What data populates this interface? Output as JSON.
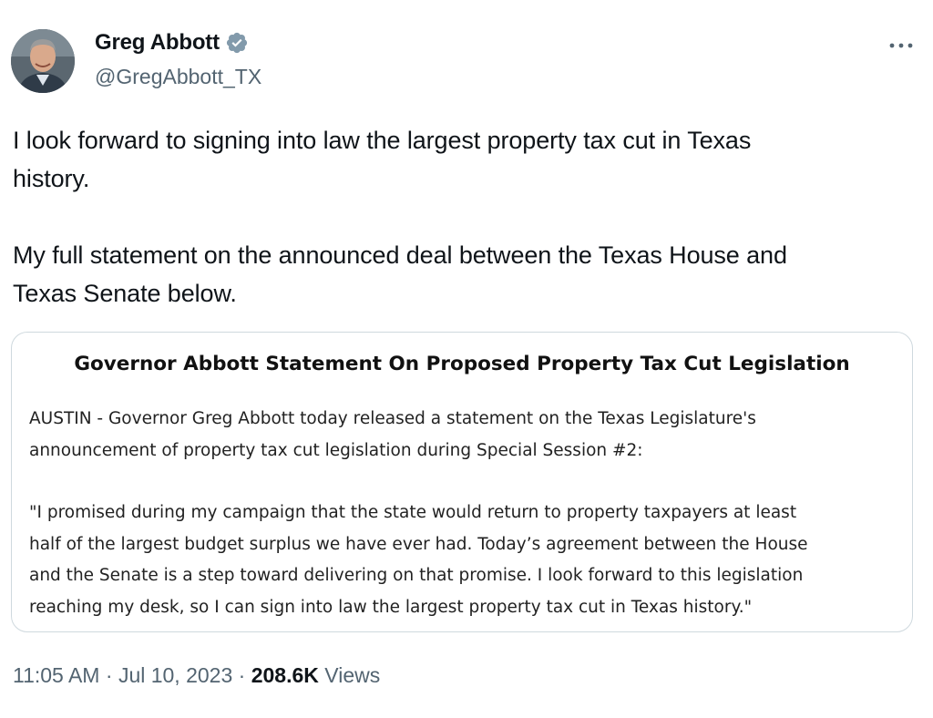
{
  "author": {
    "display_name": "Greg Abbott",
    "handle": "@GregAbbott_TX",
    "verified": true,
    "avatar_icon": "profile-photo"
  },
  "tweet": {
    "paragraph_1_line_1": "I look forward to signing into law the largest property tax cut in Texas",
    "paragraph_1_line_2": "history.",
    "paragraph_2_line_1": "My full statement on the announced deal between the Texas House and",
    "paragraph_2_line_2": "Texas Senate below."
  },
  "statement_image": {
    "title": "Governor Abbott Statement On Proposed Property Tax Cut Legislation",
    "intro_line_1": "AUSTIN - Governor Greg Abbott today released a statement on the Texas Legislature's",
    "intro_line_2": "announcement of property tax cut legislation during Special Session #2:",
    "quote_line_1": "\"I promised during my campaign that the state would return to property taxpayers at least",
    "quote_line_2": "half of the largest budget surplus we have ever had. Today’s agreement between the House",
    "quote_line_3": "and the Senate is a step toward delivering on that promise. I look forward to this legislation",
    "quote_line_4": "reaching my desk, so I can sign into law the largest property tax cut in Texas history.\""
  },
  "meta": {
    "time": "11:05 AM",
    "separator": "·",
    "date": "Jul 10, 2023",
    "views_count": "208.6K",
    "views_label": "Views"
  },
  "colors": {
    "verified_badge": "#829aab",
    "secondary_text": "#536471",
    "border": "#cfd9de"
  },
  "icons": {
    "more": "more-horizontal-icon",
    "verified": "verified-badge-icon"
  }
}
